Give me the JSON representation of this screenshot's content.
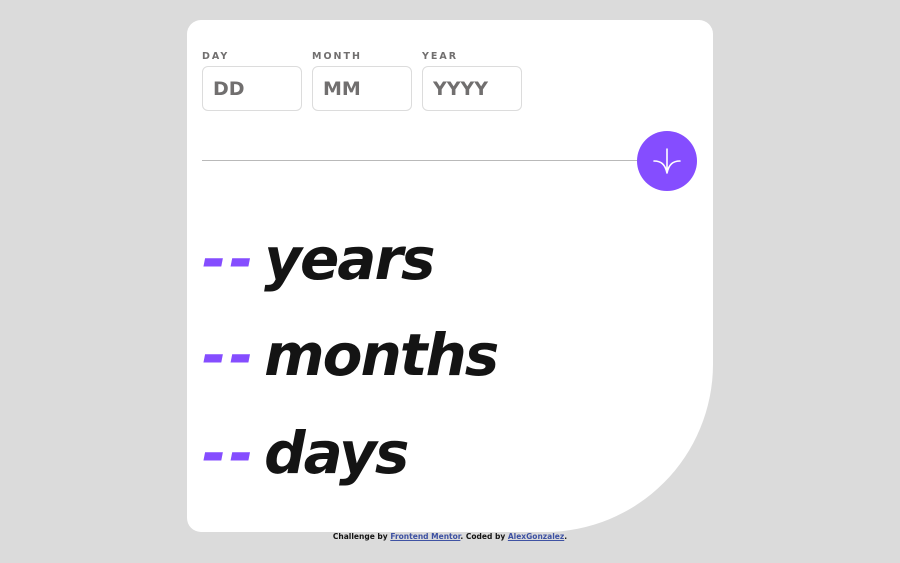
{
  "form": {
    "day": {
      "label": "DAY",
      "placeholder": "DD"
    },
    "month": {
      "label": "MONTH",
      "placeholder": "MM"
    },
    "year": {
      "label": "YEAR",
      "placeholder": "YYYY"
    },
    "submit_icon": "arrow-down-icon"
  },
  "results": [
    {
      "value": "--",
      "unit": "years"
    },
    {
      "value": "--",
      "unit": "months"
    },
    {
      "value": "--",
      "unit": "days"
    }
  ],
  "footer": {
    "prefix": "Challenge by",
    "link1": "Frontend Mentor",
    "middle": ". Coded by",
    "link2": "AlexGonzalez",
    "suffix": "."
  },
  "colors": {
    "accent": "#854dff",
    "background": "#dbdbdb",
    "card": "#ffffff",
    "text": "#141414",
    "label": "#716f6f"
  }
}
